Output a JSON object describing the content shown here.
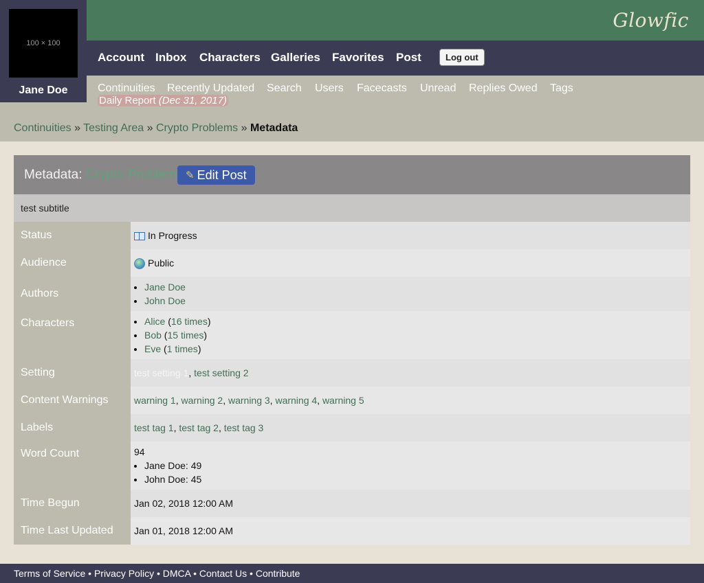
{
  "header": {
    "logo": "Glowfic",
    "avatar_placeholder": "100 × 100",
    "username": "Jane Doe",
    "nav": [
      "Account",
      "Inbox",
      "Characters",
      "Galleries",
      "Favorites",
      "Post"
    ],
    "logout": "Log out",
    "subnav": [
      "Continuities",
      "Recently Updated",
      "Search",
      "Users",
      "Facecasts",
      "Unread",
      "Replies Owed",
      "Tags"
    ],
    "daily_report": "Daily Report",
    "daily_date": "(Dec 31, 2017)"
  },
  "breadcrumb": [
    "Continuities",
    "Testing Area",
    "Crypto Problems",
    "Metadata"
  ],
  "panel": {
    "title_prefix": "Metadata:",
    "post_title": "Crypto Problems",
    "edit_label": "Edit Post",
    "subtitle": "test subtitle"
  },
  "fields": {
    "status": {
      "label": "Status",
      "value": "In Progress",
      "icon": "book-icon"
    },
    "audience": {
      "label": "Audience",
      "value": "Public",
      "icon": "globe-icon"
    },
    "authors": {
      "label": "Authors",
      "items": [
        "Jane Doe",
        "John Doe"
      ]
    },
    "characters": {
      "label": "Characters",
      "items": [
        {
          "name": "Alice",
          "count": "16 times"
        },
        {
          "name": "Bob",
          "count": "15 times"
        },
        {
          "name": "Eve",
          "count": "1 times"
        }
      ]
    },
    "setting": {
      "label": "Setting",
      "items": [
        "test setting 1",
        "test setting 2"
      ]
    },
    "warnings": {
      "label": "Content Warnings",
      "items": [
        "warning 1",
        "warning 2",
        "warning 3",
        "warning 4",
        "warning 5"
      ]
    },
    "labels": {
      "label": "Labels",
      "items": [
        "test tag 1",
        "test tag 2",
        "test tag 3"
      ]
    },
    "word_count": {
      "label": "Word Count",
      "total": "94",
      "items": [
        "Jane Doe: 49",
        "John Doe: 45"
      ]
    },
    "time_begun": {
      "label": "Time Begun",
      "value": "Jan 02, 2018 12:00 AM"
    },
    "time_updated": {
      "label": "Time Last Updated",
      "value": "Jan 01, 2018 12:00 AM"
    }
  },
  "footer": [
    "Terms of Service",
    "Privacy Policy",
    "DMCA",
    "Contact Us",
    "Contribute"
  ],
  "colors": {
    "header_green": "#4a7a5c",
    "nav_dark": "#3b3b54",
    "link_green": "#416e54",
    "edit_blue": "#3c5aa8"
  }
}
